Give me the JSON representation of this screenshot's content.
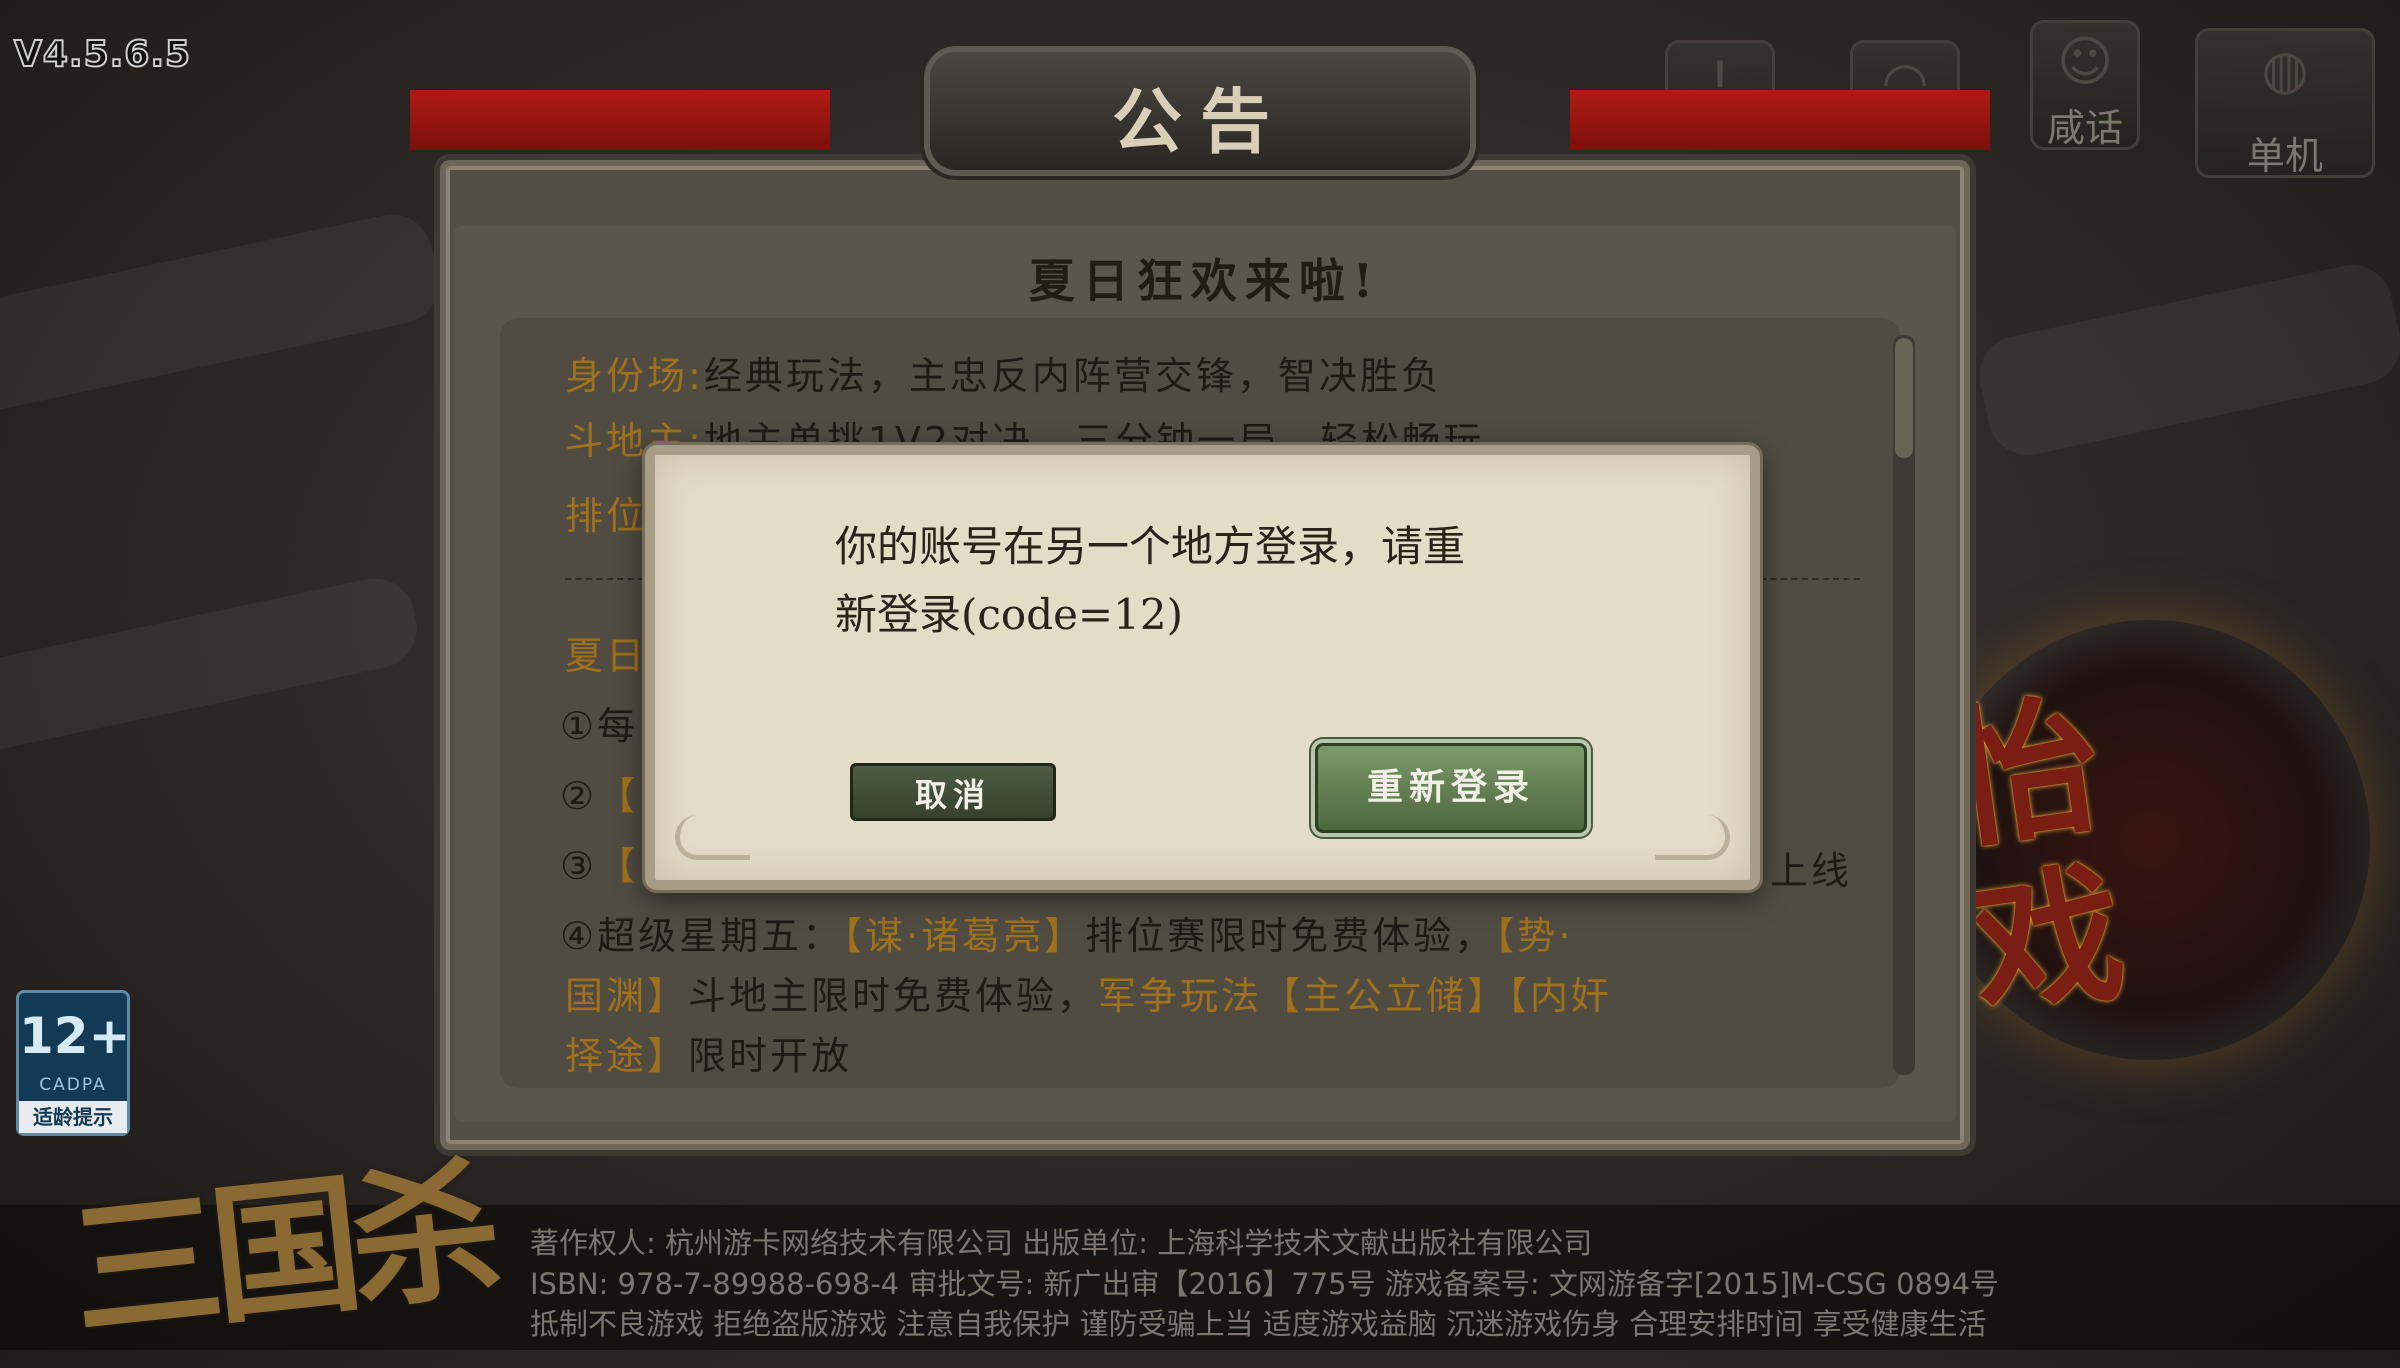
{
  "version": "V4.5.6.5",
  "top_icons": [
    {
      "name": "notice",
      "glyph": "!",
      "label": ""
    },
    {
      "name": "headset",
      "glyph": "◠",
      "label": ""
    },
    {
      "name": "chat",
      "glyph": "☺",
      "label": "咸话"
    },
    {
      "name": "single",
      "glyph": "◍",
      "label": "单机"
    }
  ],
  "announcement": {
    "title": "公告",
    "heading": "夏日狂欢来啦!",
    "lines": [
      {
        "label": "身份场:",
        "text": "经典玩法，主忠反内阵营交锋，智决胜负"
      },
      {
        "label": "斗地主:",
        "text": "地主单挑1V2对决，三分钟一局，轻松畅玩"
      },
      {
        "label": "排位",
        "text": ""
      }
    ],
    "section_label": "夏日",
    "items": [
      {
        "num": "①",
        "text": "每"
      },
      {
        "num": "②",
        "text": "【"
      },
      {
        "num": "③",
        "text": "【"
      },
      {
        "num": "④",
        "text": "超级星期五："
      }
    ],
    "item3_tail": "上线",
    "item4": {
      "hl1": "【谋·诸葛亮】",
      "t1": "排位赛限时免费体验，",
      "hl2": "【势·",
      "hl3": "国渊】",
      "t2": "斗地主限时免费体验，",
      "hl4": "军争玩法【主公立储】【内奸",
      "hl5": "择途】",
      "t3": "限时开放"
    }
  },
  "modal": {
    "message_line1": "你的账号在另一个地方登录，请重",
    "message_line2": "新登录(code=12)",
    "cancel_label": "取消",
    "relogin_label": "重新登录"
  },
  "age_badge": {
    "age": "12+",
    "org": "CADPA",
    "tip": "适龄提示"
  },
  "logo_text": "三国杀",
  "right_emblem_text": "怡戏",
  "footer": {
    "line1": "著作权人: 杭州游卡网络技术有限公司  出版单位: 上海科学技术文献出版社有限公司",
    "line2": "ISBN: 978-7-89988-698-4  审批文号: 新广出审【2016】775号  游戏备案号: 文网游备字[2015]M-CSG 0894号",
    "line3": "抵制不良游戏 拒绝盗版游戏 注意自我保护 谨防受骗上当 适度游戏益脑 沉迷游戏伤身 合理安排时间 享受健康生活"
  },
  "colors": {
    "highlight": "#a0711c",
    "button_green": "#5e7d4d",
    "panel": "#544f45",
    "modal_bg": "#e3ddc8"
  }
}
